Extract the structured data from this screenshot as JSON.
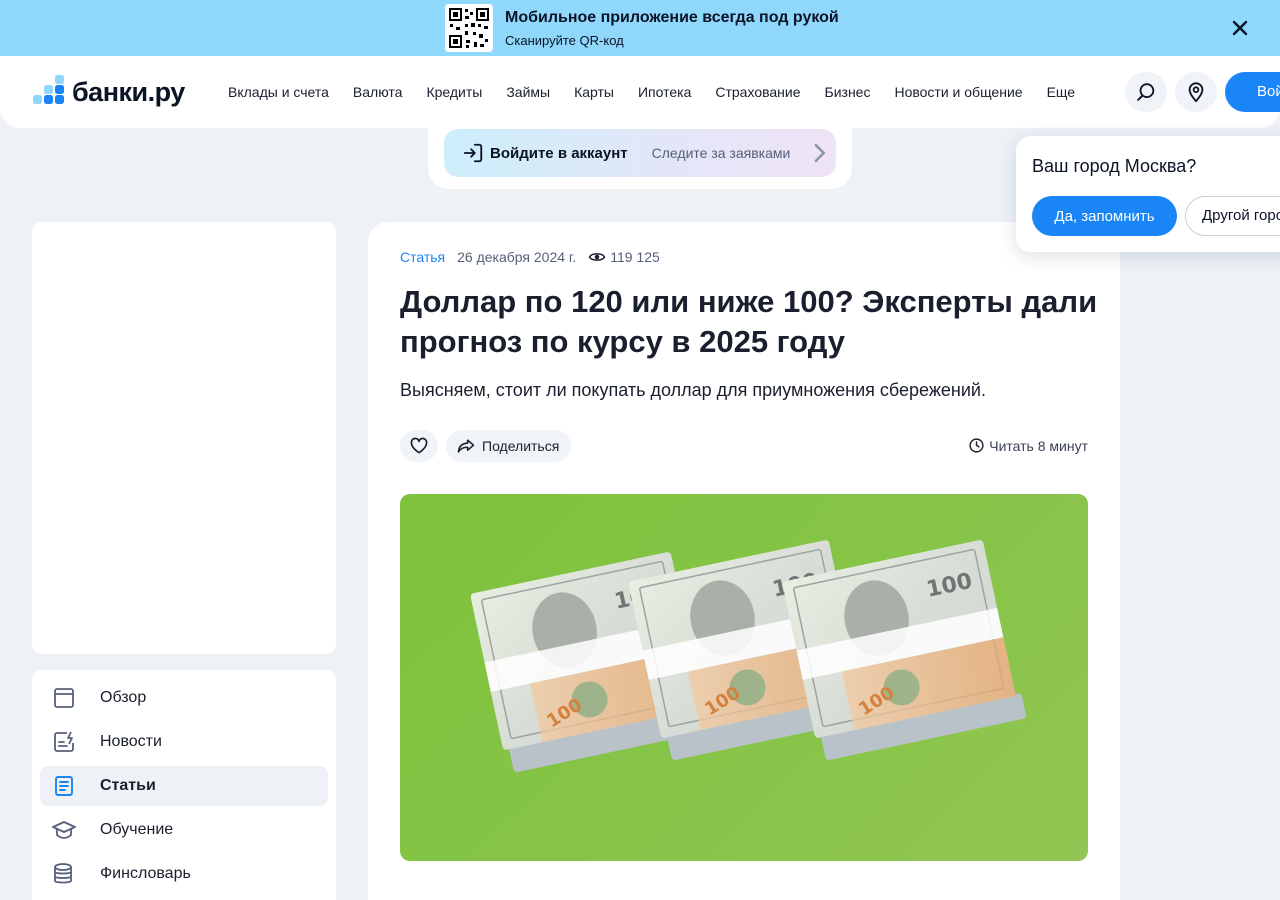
{
  "promo": {
    "title": "Мобильное приложение всегда под рукой",
    "subtitle": "Сканируйте QR-код",
    "qr_icon": "qr-code-icon",
    "close_icon": "close-icon"
  },
  "header": {
    "logo_text": "банки.ру",
    "nav": [
      "Вклады и счета",
      "Валюта",
      "Кредиты",
      "Займы",
      "Карты",
      "Ипотека",
      "Страхование",
      "Бизнес",
      "Новости и общение",
      "Еще"
    ],
    "login_label": "Войти",
    "search_icon": "search-icon",
    "location_icon": "map-pin-icon",
    "accent_color": "#1a85f7"
  },
  "account": {
    "main": "Войдите в аккаунт",
    "sub": "Следите за заявками"
  },
  "sidebar": {
    "items": [
      {
        "label": "Обзор",
        "icon": "overview-icon",
        "active": false
      },
      {
        "label": "Новости",
        "icon": "news-icon",
        "active": false
      },
      {
        "label": "Статьи",
        "icon": "articles-icon",
        "active": true
      },
      {
        "label": "Обучение",
        "icon": "graduation-cap-icon",
        "active": false
      },
      {
        "label": "Финсловарь",
        "icon": "coins-stack-icon",
        "active": false
      }
    ]
  },
  "article": {
    "category": "Статья",
    "date": "26 декабря 2024 г.",
    "views": "119 125",
    "title": "Доллар по 120 или ниже 100? Эксперты дали прогноз по курсу в 2025 году",
    "lead": "Выясняем, стоит ли покупать доллар для приумножения сбережений.",
    "share_label": "Поделиться",
    "read_time": "Читать 8 минут",
    "banknote_value": "100"
  },
  "city_popup": {
    "question": "Ваш город Москва?",
    "yes_label": "Да, запомнить",
    "other_label": "Другой город"
  }
}
